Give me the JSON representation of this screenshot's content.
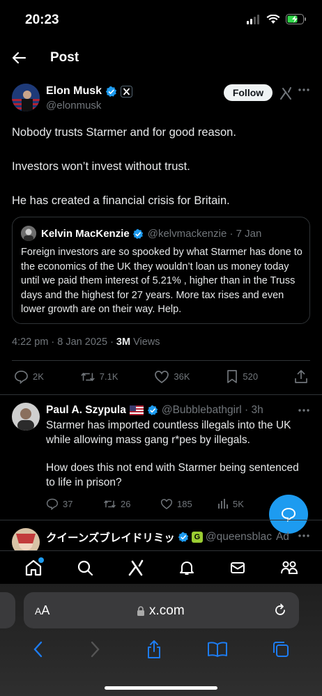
{
  "status": {
    "time": "20:23"
  },
  "header": {
    "title": "Post"
  },
  "post": {
    "author_name": "Elon Musk",
    "author_handle": "@elonmusk",
    "follow_label": "Follow",
    "paragraphs": [
      "Nobody trusts Starmer and for good reason.",
      "Investors won’t invest without trust.",
      "He has created a financial crisis for Britain."
    ],
    "quote": {
      "name": "Kelvin MacKenzie",
      "handle_date": "@kelvmackenzie · 7 Jan",
      "text": "Foreign investors are so spooked by what Starmer has done to the economics of the UK they wouldn’t loan us money today until  we paid them interest of 5.21% , higher than in the Truss days and the highest for 27 years. More tax rises and  even lower growth are on their way. Help."
    },
    "timestamp": "4:22 pm · 8 Jan 2025 · ",
    "views_count": "3M",
    "views_label": " Views",
    "actions": {
      "replies": "2K",
      "reposts": "7.1K",
      "likes": "36K",
      "bookmarks": "520"
    }
  },
  "reply1": {
    "name": "Paul A. Szypula",
    "handle_time": "@Bubblebathgirl · 3h",
    "paragraphs": [
      "Starmer has imported countless illegals into the UK while allowing mass gang r*pes by illegals.",
      "How does this not end with Starmer being sentenced to life in prison?"
    ],
    "actions": {
      "replies": "37",
      "reposts": "26",
      "likes": "185",
      "views": "5K"
    }
  },
  "reply2": {
    "name": "クイーンズブレイドリミッ",
    "badge": "G",
    "handle": "@queensblac",
    "ad_label": "Ad"
  },
  "browser": {
    "aa_label_small": "A",
    "aa_label_large": "A",
    "url": "x.com"
  },
  "colors": {
    "accent": "#1d9bf0",
    "background": "#000000",
    "muted": "#71767b",
    "text": "#e7e9ea"
  }
}
